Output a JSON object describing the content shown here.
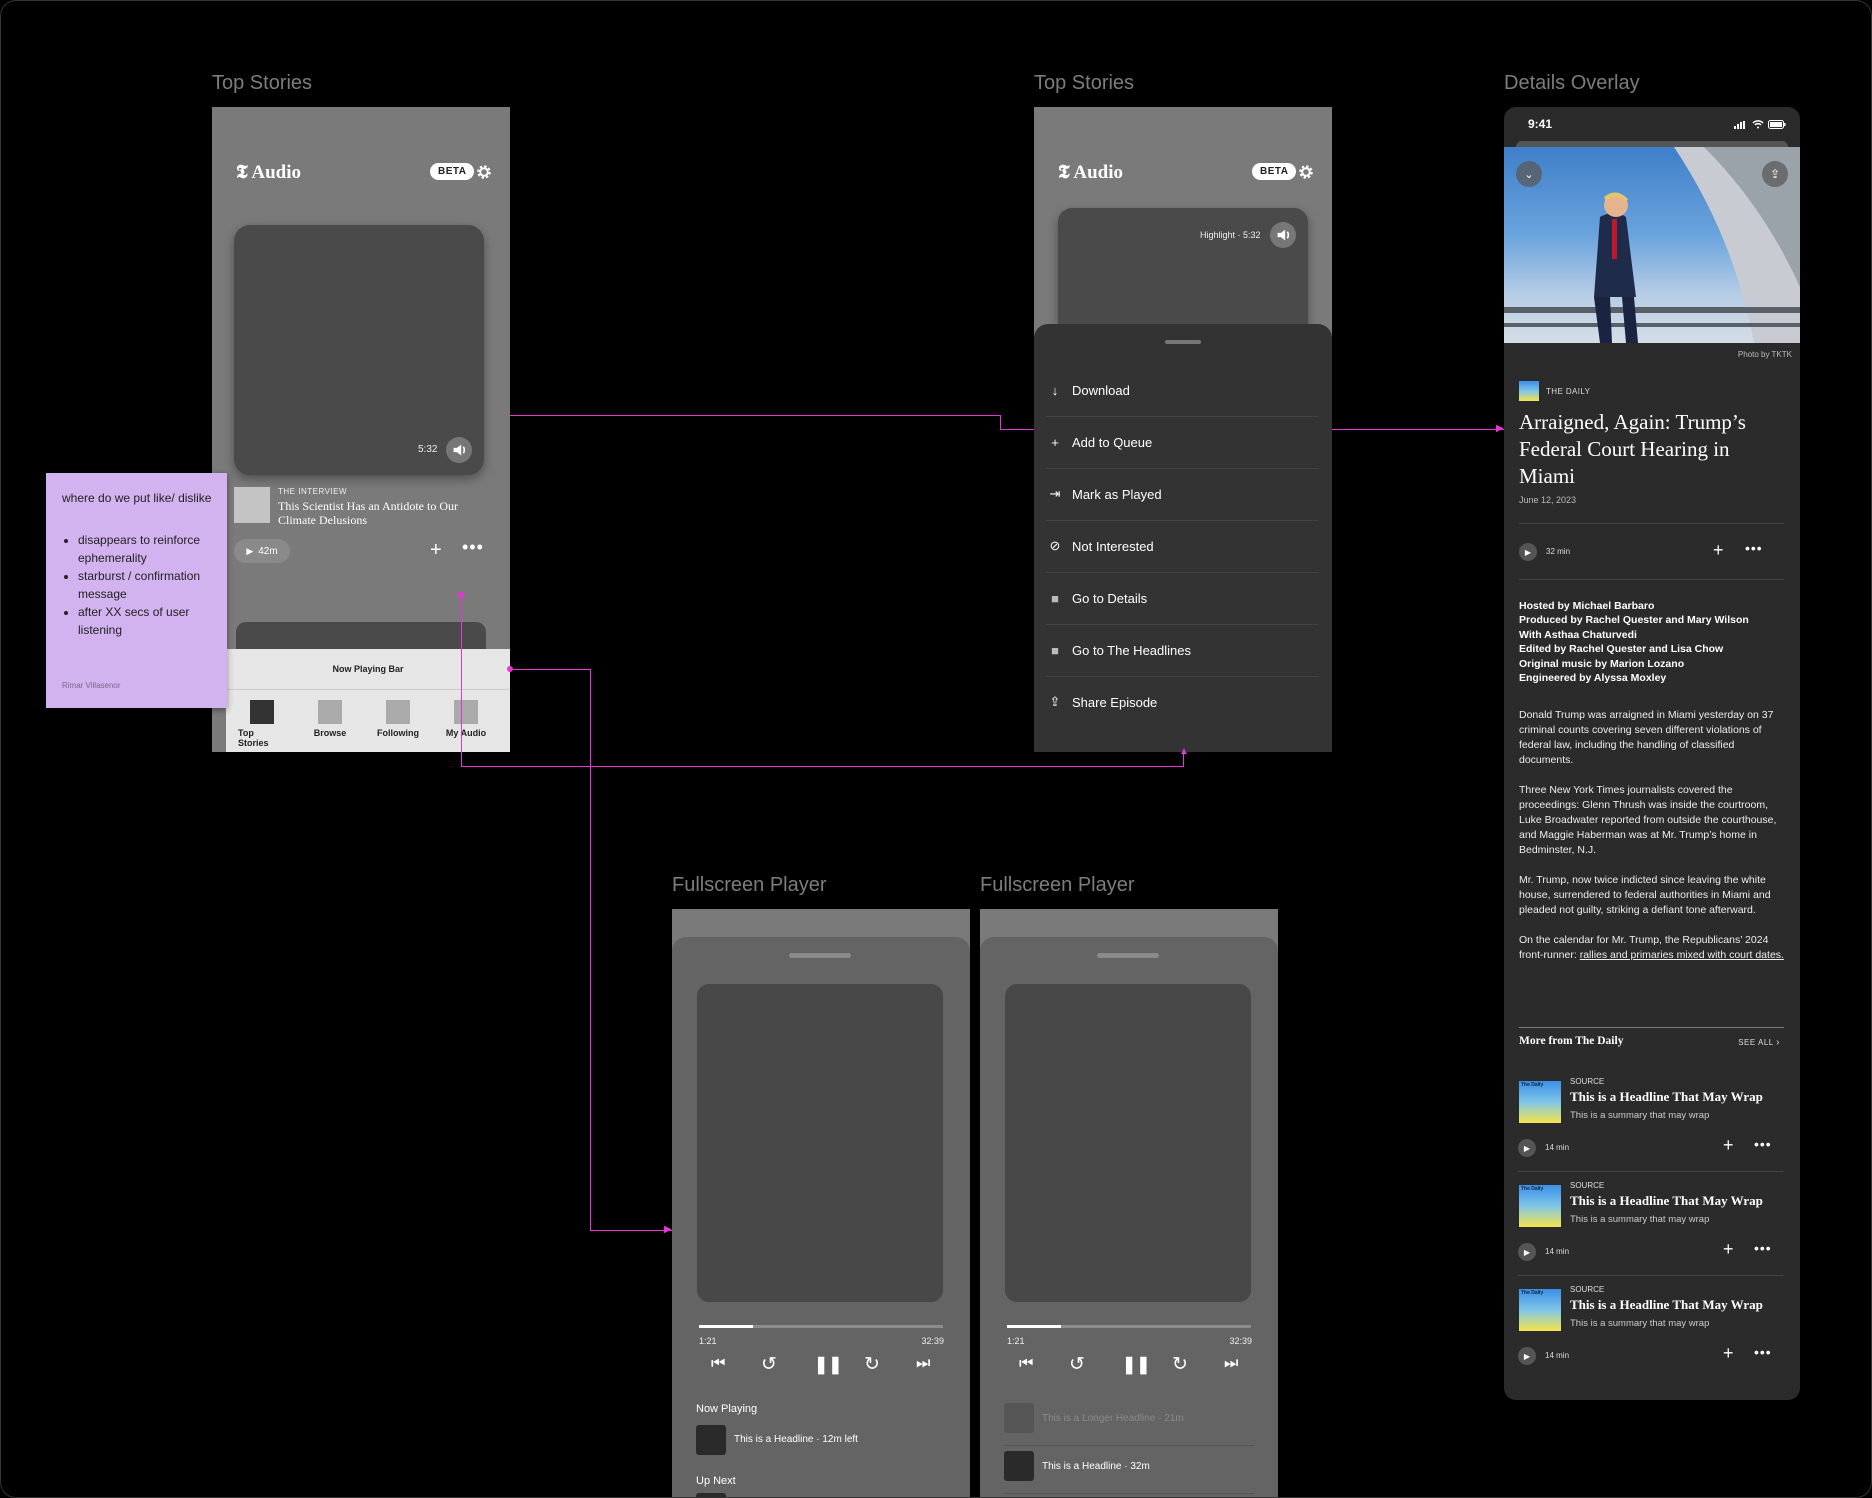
{
  "labels": {
    "top_stories_1": "Top Stories",
    "top_stories_2": "Top Stories",
    "details_overlay": "Details Overlay",
    "fullscreen_1": "Fullscreen Player",
    "fullscreen_2": "Fullscreen Player"
  },
  "app": {
    "logo": "𝕿 Audio",
    "beta": "BETA"
  },
  "screen1": {
    "duration": "5:32",
    "kicker": "THE INTERVIEW",
    "headline": "This Scientist Has an Antidote to Our Climate Delusions",
    "play_label": "42m",
    "now_playing": "Now Playing Bar",
    "tabs": [
      "Top Stories",
      "Browse",
      "Following",
      "My Audio"
    ]
  },
  "sticky": {
    "title": "where do we put like/ dislike",
    "bullets": [
      "disappears to reinforce ephemerality",
      "starburst / confirmation message",
      "after XX secs of user listening"
    ],
    "author": "Rimar Villasenor"
  },
  "screen2": {
    "highlight": "Highlight · 5:32",
    "menu": [
      "Download",
      "Add to Queue",
      "Mark as Played",
      "Not Interested",
      "Go to Details",
      "Go to The Headlines",
      "Share Episode"
    ],
    "menu_icons": [
      "↓",
      "+",
      "⇥",
      "⊘",
      "■",
      "■",
      "⇪"
    ]
  },
  "details": {
    "time": "9:41",
    "photo_credit": "Photo by TKTK",
    "show": "THE DAILY",
    "title": "Arraigned, Again: Trump’s Federal Court Hearing in Miami",
    "date": "June 12, 2023",
    "duration": "32 min",
    "credits": [
      "Hosted by Michael Barbaro",
      "Produced by Rachel Quester and Mary Wilson",
      "With Asthaa Chaturvedi",
      "Edited by Rachel Quester and Lisa Chow",
      "Original music by Marion Lozano",
      "Engineered by Alyssa Moxley"
    ],
    "paras": [
      "Donald Trump was arraigned in Miami yesterday on 37 criminal counts covering seven different violations of federal law, including the handling of classified documents.",
      "Three New York Times journalists covered the proceedings: Glenn Thrush was inside the courtroom, Luke Broadwater reported from outside the courthouse, and Maggie Haberman was at Mr. Trump’s home in Bedminster, N.J.",
      "Mr. Trump, now twice indicted since leaving the white house, surrendered to federal authorities in Miami and pleaded not guilty, striking a defiant tone afterward."
    ],
    "last_para_a": "On the calendar for Mr. Trump, the Republicans’ 2024 front-runner: ",
    "last_para_link": "rallies and primaries mixed with court dates.",
    "more_title": "More from The Daily",
    "see_all": "SEE ALL",
    "more": [
      {
        "source": "SOURCE",
        "headline": "This is a Headline That May Wrap",
        "summary": "This is a summary that may wrap",
        "duration": "14 min"
      },
      {
        "source": "SOURCE",
        "headline": "This is a Headline That May Wrap",
        "summary": "This is a summary that may wrap",
        "duration": "14 min"
      },
      {
        "source": "SOURCE",
        "headline": "This is a Headline That May Wrap",
        "summary": "This is a summary that may wrap",
        "duration": "14 min"
      }
    ],
    "thumb_text": "The Daily"
  },
  "player1": {
    "elapsed": "1:21",
    "total": "32:39",
    "progress": 0.22,
    "now_playing_label": "Now Playing",
    "now_playing_item": "This is a Headline · 12m left",
    "up_next": "Up Next"
  },
  "player2": {
    "elapsed": "1:21",
    "total": "32:39",
    "progress": 0.22,
    "item1": "This is a Longer Headline · 21m",
    "item2": "This is a Headline · 32m"
  }
}
